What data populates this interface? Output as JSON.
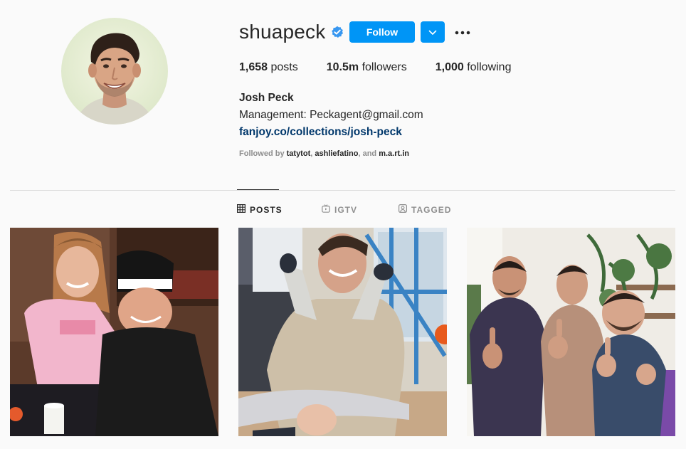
{
  "profile": {
    "username": "shuapeck",
    "verified": true,
    "follow_label": "Follow",
    "stats": {
      "posts_count": "1,658",
      "posts_label": "posts",
      "followers_count": "10.5m",
      "followers_label": "followers",
      "following_count": "1,000",
      "following_label": "following"
    },
    "full_name": "Josh Peck",
    "bio_line": "Management: Peckagent@gmail.com",
    "link": "fanjoy.co/collections/josh-peck",
    "followed_by": {
      "prefix": "Followed by",
      "user1": "tatytot",
      "sep1": ",",
      "user2": "ashliefatino",
      "sep2": ", and",
      "user3": "m.a.rt.in"
    }
  },
  "tabs": [
    {
      "label": "POSTS",
      "icon": "grid-icon",
      "active": true
    },
    {
      "label": "IGTV",
      "icon": "igtv-icon",
      "active": false
    },
    {
      "label": "TAGGED",
      "icon": "tagged-icon",
      "active": false
    }
  ],
  "posts": [
    {
      "icon": "photo-kids-beanie"
    },
    {
      "icon": "photo-man-holding-child"
    },
    {
      "icon": "photo-three-men-thumbs-up"
    }
  ],
  "colors": {
    "accent": "#0095f6",
    "link": "#00376b",
    "muted": "#8e8e8e",
    "text": "#262626",
    "background": "#fafafa"
  }
}
